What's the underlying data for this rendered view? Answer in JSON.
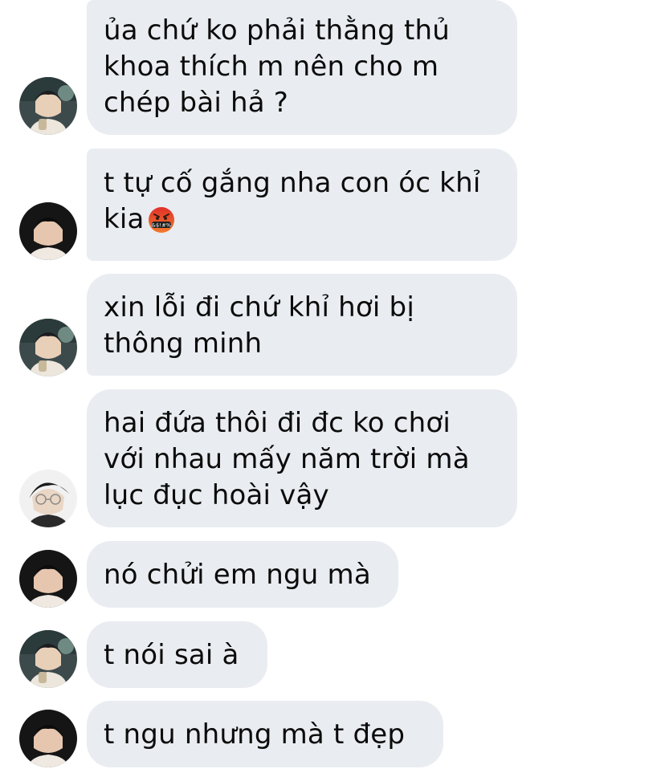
{
  "conversation": {
    "messages": [
      {
        "sender": "friend-a",
        "lines": [
          "ủa chứ ko phải thằng thủ",
          "khoa thích m nên cho m",
          "chép bài hả ?"
        ]
      },
      {
        "sender": "friend-b",
        "lines": [
          "t tự cố gắng nha con óc khỉ",
          "kia"
        ],
        "emoji": "face-with-symbols-on-mouth"
      },
      {
        "sender": "friend-a",
        "lines": [
          "xin lỗi đi chứ khỉ hơi bị",
          "thông minh"
        ]
      },
      {
        "sender": "friend-c",
        "lines": [
          "hai đứa thôi đi đc ko chơi",
          "với nhau mấy năm trời mà",
          "lục đục hoài vậy"
        ]
      },
      {
        "sender": "friend-b",
        "lines": [
          "nó chửi em ngu mà"
        ]
      },
      {
        "sender": "friend-a",
        "lines": [
          "t nói sai à"
        ]
      },
      {
        "sender": "friend-b",
        "lines": [
          "t ngu nhưng mà t đẹp"
        ]
      }
    ]
  },
  "emoji": {
    "face-with-symbols-on-mouth": {
      "name": "face-with-symbols-on-mouth-emoji",
      "symbols": "&$!#%",
      "colors": {
        "face_top": "#e0302a",
        "face_bottom": "#f27b2c",
        "bar": "#1f1f1f"
      }
    }
  },
  "colors": {
    "bubble_bg": "#e9ecf0",
    "text": "#0b0b0b",
    "background": "#ffffff"
  }
}
